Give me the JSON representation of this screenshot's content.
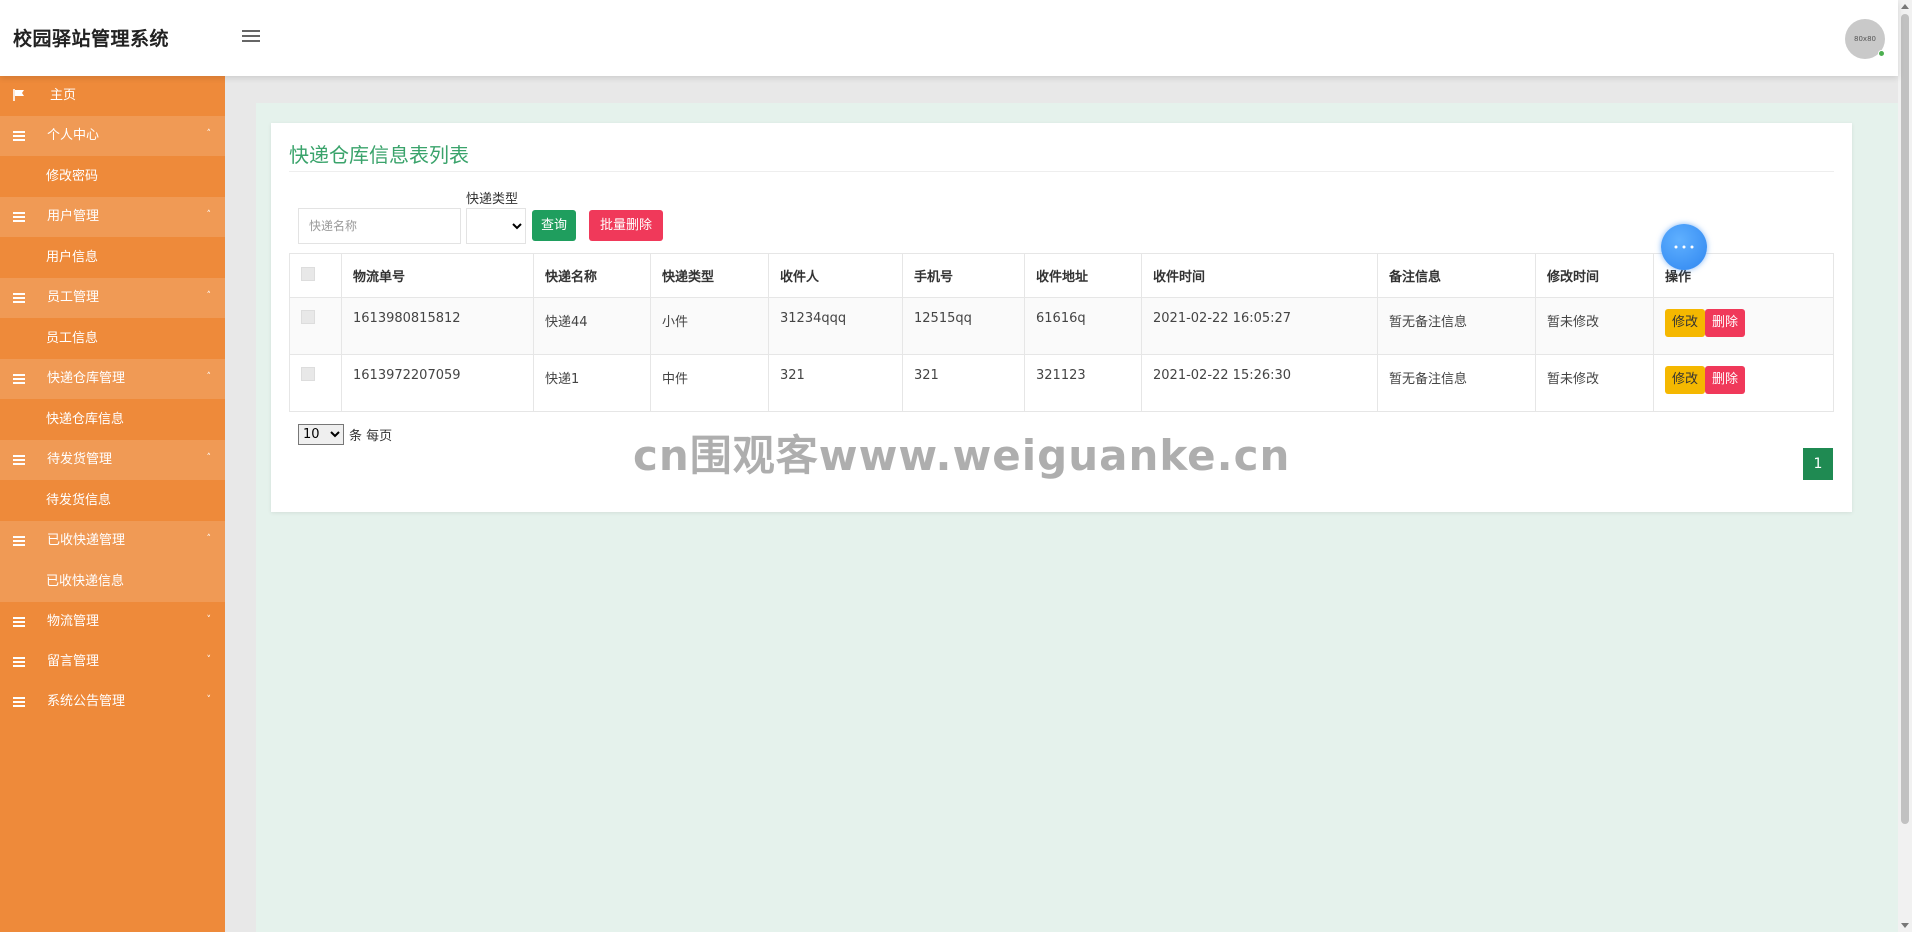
{
  "header": {
    "brand": "校园驿站管理系统",
    "avatar_text": "80x80"
  },
  "sidebar": {
    "home": "主页",
    "groups": [
      {
        "label": "个人中心",
        "sub": "修改密码"
      },
      {
        "label": "用户管理",
        "sub": "用户信息"
      },
      {
        "label": "员工管理",
        "sub": "员工信息"
      },
      {
        "label": "快递仓库管理",
        "sub": "快递仓库信息"
      },
      {
        "label": "待发货管理",
        "sub": "待发货信息"
      },
      {
        "label": "已收快递管理",
        "sub": "已收快递信息"
      }
    ],
    "collapsed": [
      "物流管理",
      "留言管理",
      "系统公告管理"
    ],
    "caret": "˄",
    "caret_collapsed": "˅"
  },
  "main": {
    "title": "快递仓库信息表列表",
    "search_placeholder": "快递名称",
    "type_label": "快递类型",
    "query_button": "查询",
    "batch_delete_button": "批量删除",
    "columns": [
      "物流单号",
      "快递名称",
      "快递类型",
      "收件人",
      "手机号",
      "收件地址",
      "收件时间",
      "备注信息",
      "修改时间",
      "操作"
    ],
    "rows": [
      [
        "1613980815812",
        "快递44",
        "小件",
        "31234qqq",
        "12515qq",
        "61616q",
        "2021-02-22 16:05:27",
        "暂无备注信息",
        "暂未修改"
      ],
      [
        "1613972207059",
        "快递1",
        "中件",
        "321",
        "321",
        "321123",
        "2021-02-22 15:26:30",
        "暂无备注信息",
        "暂未修改"
      ]
    ],
    "edit_button": "修改",
    "delete_button": "删除",
    "per_page_value": "10",
    "per_page_suffix": "条 每页",
    "current_page": "1"
  },
  "watermark": "cn围观客www.weiguanke.cn",
  "colors": {
    "sidebar": "#ee8a3a",
    "accent_green": "#1f9e5e",
    "danger": "#f0395a",
    "warning": "#f5b800",
    "title_green": "#3aa36b"
  }
}
